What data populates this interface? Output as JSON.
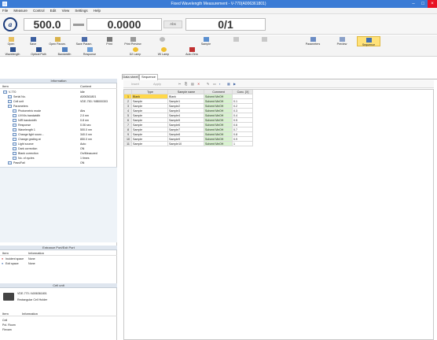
{
  "window": {
    "title": "Fixed Wavelength Measurement - V-770(A006361801)"
  },
  "menu": [
    "File",
    "Measure",
    "Control",
    "Edit",
    "View",
    "Settings",
    "Help"
  ],
  "meter": {
    "wavelength": "500.0",
    "absorbance": "0.0000",
    "unit": "Abs",
    "count": "0/1"
  },
  "toolbar": {
    "row1": [
      {
        "label": "Open",
        "icon": "folder-icon"
      },
      {
        "label": "Save",
        "icon": "save-icon"
      },
      {
        "label": "Open Param.",
        "icon": "open-param-icon"
      },
      {
        "label": "Save Param.",
        "icon": "save-param-icon"
      },
      {
        "label": "Print",
        "icon": "print-icon"
      },
      {
        "label": "Print Preview",
        "icon": "print-preview-icon"
      },
      {
        "label": "",
        "icon": "disc-icon"
      },
      {
        "label": "Sample",
        "icon": "sample-icon"
      },
      {
        "label": "",
        "icon": "blank-icon"
      },
      {
        "label": "",
        "icon": "blank2-icon"
      },
      {
        "label": "Parameters",
        "icon": "parameters-icon"
      },
      {
        "label": "Preview",
        "icon": "preview-icon"
      },
      {
        "label": "Sequence",
        "icon": "sequence-icon"
      }
    ],
    "row2": [
      {
        "label": "Wavelength",
        "icon": "wavelength-icon"
      },
      {
        "label": "Optical Path",
        "icon": "optical-path-icon"
      },
      {
        "label": "Bandwidth",
        "icon": "bandwidth-icon"
      },
      {
        "label": "Response",
        "icon": "response-icon"
      },
      {
        "label": "D2 Lamp",
        "icon": "d2-lamp-icon"
      },
      {
        "label": "WI Lamp",
        "icon": "wi-lamp-icon"
      },
      {
        "label": "Auto Zero",
        "icon": "auto-zero-icon"
      }
    ]
  },
  "info": {
    "header": "Information",
    "col_item": "Item",
    "col_content": "Content",
    "rows": [
      {
        "item": "V-770",
        "content": "Idle",
        "level": 0
      },
      {
        "item": "Serial No.",
        "content": "A006361801",
        "level": 1
      },
      {
        "item": "Cell unit",
        "content": "VDE-750 / MB000303",
        "level": 1
      },
      {
        "item": "Parameters",
        "content": "",
        "level": 1
      },
      {
        "item": "Photometric mode",
        "content": "Abs",
        "level": 2
      },
      {
        "item": "UV/Vis bandwidth",
        "content": "2.0 nm",
        "level": 2
      },
      {
        "item": "NIR bandwidth",
        "content": "0.8 nm",
        "level": 2
      },
      {
        "item": "Response",
        "content": "0.06 sec",
        "level": 2
      },
      {
        "item": "Wavelength 1",
        "content": "500.0 nm",
        "level": 2
      },
      {
        "item": "Change light sourc...",
        "content": "340.0 nm",
        "level": 2
      },
      {
        "item": "Change grating at",
        "content": "850.0 nm",
        "level": 2
      },
      {
        "item": "Light source",
        "content": "Auto",
        "level": 2
      },
      {
        "item": "Dark correction",
        "content": "ON",
        "level": 2
      },
      {
        "item": "Blank correction",
        "content": "On/Measured",
        "level": 2
      },
      {
        "item": "No. of cycles",
        "content": "1 times",
        "level": 2
      },
      {
        "item": "Pass/Fail",
        "content": "ON",
        "level": 1
      }
    ]
  },
  "port": {
    "header": "Entrance Port/Exit Port",
    "col_item": "Item",
    "col_info": "Information",
    "rows": [
      {
        "item": "Incident space",
        "info": "None"
      },
      {
        "item": "Exit space",
        "info": "None"
      }
    ]
  },
  "cellunit": {
    "header": "Cell unit",
    "name": "VDE-770 / A006361801",
    "model": "Rectangular Cell Holder",
    "col_item": "Item",
    "col_info": "Information",
    "rows": [
      "Cell",
      "Pol. Room",
      "Flexam"
    ]
  },
  "tabs": [
    "Data sheet",
    "Sequence"
  ],
  "tabtool": [
    "Insert",
    "Apply"
  ],
  "sequence": {
    "headers": [
      "",
      "Type",
      "Sample name",
      "Comment",
      "Conc. [X]"
    ],
    "rows": [
      {
        "no": "1",
        "type": "Blank",
        "name": "Blank",
        "comment": "Solvent MeOH",
        "conc": ""
      },
      {
        "no": "2",
        "type": "Sample",
        "name": "Sample1",
        "comment": "Solvent MeOH",
        "conc": "0.1"
      },
      {
        "no": "3",
        "type": "Sample",
        "name": "Sample2",
        "comment": "Solvent MeOH",
        "conc": "0.2"
      },
      {
        "no": "4",
        "type": "Sample",
        "name": "Sample3",
        "comment": "Solvent MeOH",
        "conc": "0.3"
      },
      {
        "no": "5",
        "type": "Sample",
        "name": "Sample4",
        "comment": "Solvent MeOH",
        "conc": "0.4"
      },
      {
        "no": "6",
        "type": "Sample",
        "name": "Sample5",
        "comment": "Solvent MeOH",
        "conc": "0.5"
      },
      {
        "no": "7",
        "type": "Sample",
        "name": "Sample6",
        "comment": "Solvent MeOH",
        "conc": "0.6"
      },
      {
        "no": "8",
        "type": "Sample",
        "name": "Sample7",
        "comment": "Solvent MeOH",
        "conc": "0.7"
      },
      {
        "no": "9",
        "type": "Sample",
        "name": "Sample8",
        "comment": "Solvent MeOH",
        "conc": "0.8"
      },
      {
        "no": "10",
        "type": "Sample",
        "name": "Sample9",
        "comment": "Solvent MeOH",
        "conc": "0.9"
      },
      {
        "no": "11",
        "type": "Sample",
        "name": "Sample10",
        "comment": "Solvent MeOH",
        "conc": "1"
      }
    ]
  },
  "colors": {
    "titlebar": "#3a7bd5",
    "active": "#ffe27a",
    "selected_cell": "#ffd84a"
  }
}
